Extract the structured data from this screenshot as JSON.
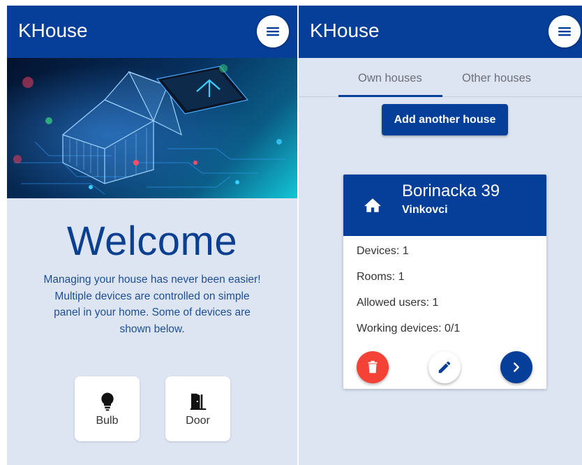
{
  "left_screen": {
    "app_title": "KHouse",
    "menu_icon": "menu-icon",
    "welcome_title": "Welcome",
    "intro_lines": [
      "Managing your house has never been easier!",
      "Multiple devices are controlled on simple",
      "panel in your home. Some of devices are",
      "shown below."
    ],
    "devices": [
      {
        "label": "Bulb",
        "icon": "bulb-icon"
      },
      {
        "label": "Door",
        "icon": "door-icon"
      }
    ]
  },
  "right_screen": {
    "app_title": "KHouse",
    "menu_icon": "menu-icon",
    "tabs": [
      {
        "label": "Own houses",
        "active": true
      },
      {
        "label": "Other houses",
        "active": false
      }
    ],
    "add_button_label": "Add another house",
    "house_card": {
      "icon": "home-icon",
      "name": "Borinacka 39",
      "city": "Vinkovci",
      "devices": "Devices: 1",
      "rooms": "Rooms: 1",
      "allowed_users": "Allowed users: 1",
      "working_devices": "Working devices: 0/1",
      "buttons": [
        "delete-icon",
        "edit-icon",
        "chevron-right-icon"
      ]
    }
  },
  "colors": {
    "primary": "#063f99",
    "background": "#dde5f3",
    "danger": "#f44336"
  }
}
